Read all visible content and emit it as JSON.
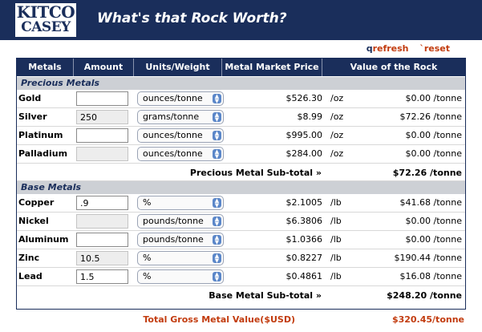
{
  "header": {
    "logo_line1": "KITCO",
    "logo_line2": "CASEY",
    "title": "What's that Rock Worth?"
  },
  "links": {
    "refresh_prefix": "q",
    "refresh": "refresh",
    "reset_prefix": "`",
    "reset": "reset"
  },
  "table": {
    "headers": [
      "Metals",
      "Amount",
      "Units/Weight",
      "Metal Market Price",
      "Value of the Rock"
    ],
    "precious_label": "Precious Metals",
    "precious": [
      {
        "name": "Gold",
        "amount": "",
        "amount_enabled": true,
        "unit_select": "ounces/tonne",
        "price": "$526.30",
        "price_unit": "/oz",
        "value": "$0.00 /tonne"
      },
      {
        "name": "Silver",
        "amount": "250",
        "amount_enabled": false,
        "unit_select": "grams/tonne",
        "price": "$8.99",
        "price_unit": "/oz",
        "value": "$72.26 /tonne"
      },
      {
        "name": "Platinum",
        "amount": "",
        "amount_enabled": true,
        "unit_select": "ounces/tonne",
        "price": "$995.00",
        "price_unit": "/oz",
        "value": "$0.00 /tonne"
      },
      {
        "name": "Palladium",
        "amount": "",
        "amount_enabled": false,
        "unit_select": "ounces/tonne",
        "price": "$284.00",
        "price_unit": "/oz",
        "value": "$0.00 /tonne"
      }
    ],
    "precious_subtotal_label": "Precious Metal Sub-total »",
    "precious_subtotal": "$72.26 /tonne",
    "base_label": "Base Metals",
    "base": [
      {
        "name": "Copper",
        "amount": ".9",
        "amount_enabled": true,
        "unit_select": "%",
        "price": "$2.1005",
        "price_unit": "/lb",
        "value": "$41.68 /tonne"
      },
      {
        "name": "Nickel",
        "amount": "",
        "amount_enabled": false,
        "unit_select": "pounds/tonne",
        "price": "$6.3806",
        "price_unit": "/lb",
        "value": "$0.00 /tonne"
      },
      {
        "name": "Aluminum",
        "amount": "",
        "amount_enabled": true,
        "unit_select": "pounds/tonne",
        "price": "$1.0366",
        "price_unit": "/lb",
        "value": "$0.00 /tonne"
      },
      {
        "name": "Zinc",
        "amount": "10.5",
        "amount_enabled": false,
        "unit_select": "%",
        "price": "$0.8227",
        "price_unit": "/lb",
        "value": "$190.44 /tonne"
      },
      {
        "name": "Lead",
        "amount": "1.5",
        "amount_enabled": true,
        "unit_select": "%",
        "price": "$0.4861",
        "price_unit": "/lb",
        "value": "$16.08 /tonne"
      }
    ],
    "base_subtotal_label": "Base Metal Sub-total »",
    "base_subtotal": "$248.20 /tonne"
  },
  "total": {
    "label": "Total Gross Metal Value($USD)",
    "value": "$320.45/tonne"
  },
  "colors": {
    "navy": "#1a2e5b",
    "accent": "#c23b0e",
    "section_bg": "#cdd0d5"
  }
}
